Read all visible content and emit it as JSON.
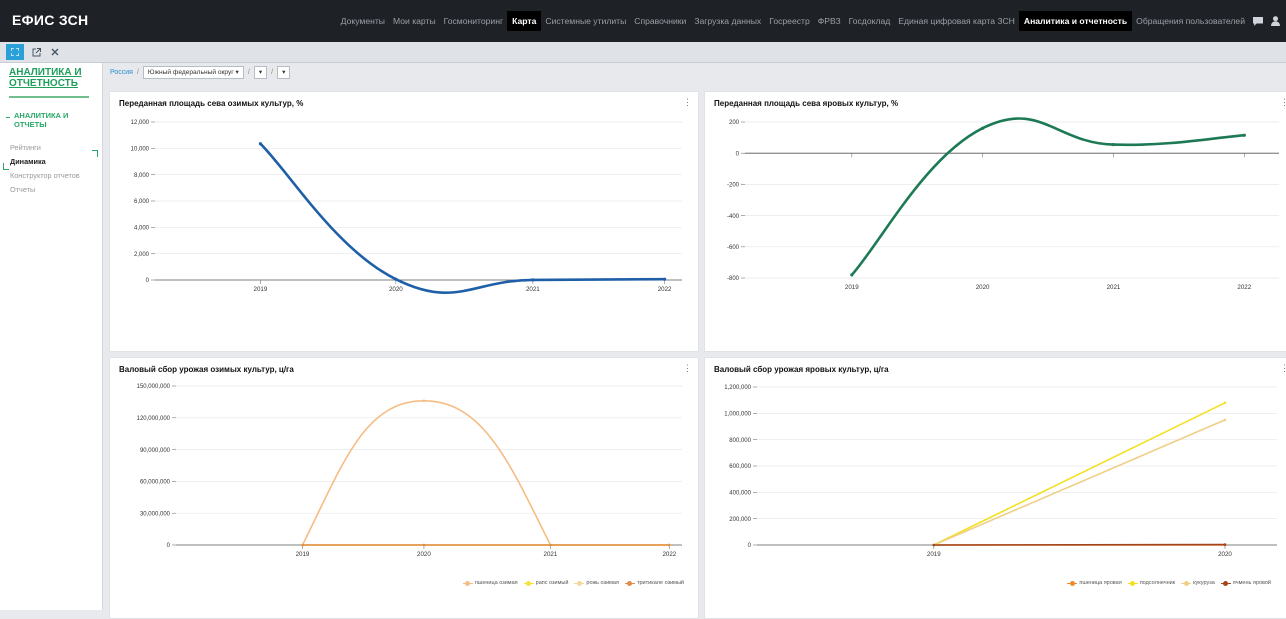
{
  "app": {
    "logo": "ЕФИС ЗСН"
  },
  "nav": {
    "items": [
      {
        "label": "Документы",
        "active": false
      },
      {
        "label": "Мои карты",
        "active": false
      },
      {
        "label": "Госмониторинг",
        "active": false
      },
      {
        "label": "Карта",
        "active": true
      },
      {
        "label": "Системные утилиты",
        "active": false
      },
      {
        "label": "Справочники",
        "active": false
      },
      {
        "label": "Загрузка данных",
        "active": false
      },
      {
        "label": "Госреестр",
        "active": false
      },
      {
        "label": "ФРВЗ",
        "active": false
      },
      {
        "label": "Госдоклад",
        "active": false
      },
      {
        "label": "Единая цифровая карта ЗСН",
        "active": false
      },
      {
        "label": "Аналитика и отчетность",
        "active": true
      },
      {
        "label": "Обращения пользователей",
        "active": false
      }
    ],
    "icons": [
      "message-icon",
      "user-icon"
    ]
  },
  "toolbar": {
    "icons": [
      "expand-icon",
      "external-link-icon",
      "close-icon"
    ]
  },
  "sidebar": {
    "title": "АНАЛИТИКА И ОТЧЕТНОСТЬ",
    "section": "АНАЛИТИКА И ОТЧЕТЫ",
    "items": [
      {
        "label": "Рейтинги",
        "active": false
      },
      {
        "label": "Динамика",
        "active": true
      },
      {
        "label": "Конструктор отчетов",
        "active": false
      },
      {
        "label": "Отчеты",
        "active": false
      }
    ]
  },
  "breadcrumb": {
    "root": "Россия",
    "district": "Южный федеральный округ",
    "select2": "",
    "select3": ""
  },
  "colors": {
    "accent": "#2aa0d8",
    "green": "#1f9e5c"
  },
  "chart_data": [
    {
      "type": "line",
      "title": "Переданная площадь сева озимых культур, %",
      "x": [
        "2019",
        "2020",
        "2021",
        "2022"
      ],
      "series": [
        {
          "values": [
            10350,
            60,
            10,
            60
          ],
          "color": "#1f5fa8"
        }
      ],
      "ylim": [
        0,
        12000
      ],
      "yticks": [
        "0",
        "2,000",
        "4,000",
        "6,000",
        "8,000",
        "10,000",
        "12,000"
      ],
      "grid": true
    },
    {
      "type": "line",
      "title": "Переданная площадь сева яровых культур, %",
      "x": [
        "2019",
        "2020",
        "2021",
        "2022"
      ],
      "series": [
        {
          "values": [
            -780,
            160,
            55,
            115
          ],
          "color": "#1d7a55"
        }
      ],
      "ylim": [
        -800,
        200
      ],
      "yticks": [
        "-800",
        "-600",
        "-400",
        "-200",
        "0",
        "200"
      ],
      "grid": true
    },
    {
      "type": "line",
      "title": "Валовый сбор урожая озимых культур, ц/га",
      "x": [
        "2019",
        "2020",
        "2021",
        "2022"
      ],
      "series": [
        {
          "name": "пшеница озимая",
          "values": [
            0,
            136000000,
            0,
            0
          ],
          "color": "#f5bd84"
        },
        {
          "name": "рапс озимый",
          "values": [
            0,
            0,
            0,
            0
          ],
          "color": "#f2e23a"
        },
        {
          "name": "рожь озимая",
          "values": [
            0,
            0,
            0,
            0
          ],
          "color": "#f5d79a"
        },
        {
          "name": "тритикале озимый",
          "values": [
            0,
            0,
            0,
            0
          ],
          "color": "#e08d4a"
        }
      ],
      "ylim": [
        0,
        150000000
      ],
      "yticks": [
        "0",
        "30,000,000",
        "60,000,000",
        "90,000,000",
        "120,000,000",
        "150,000,000"
      ],
      "grid": true,
      "legend": "bottom-right"
    },
    {
      "type": "line",
      "title": "Валовый сбор урожая яровых культур, ц/га",
      "x": [
        "2019",
        "2020"
      ],
      "series": [
        {
          "name": "пшеница яровая",
          "values": [
            0,
            0
          ],
          "color": "#ef8a2a"
        },
        {
          "name": "подсолнечник",
          "values": [
            0,
            1080000
          ],
          "color": "#f4e021"
        },
        {
          "name": "кукуруза",
          "values": [
            0,
            950000
          ],
          "color": "#efcf86"
        },
        {
          "name": "ячмень яровой",
          "values": [
            0,
            3000
          ],
          "color": "#a0451d"
        }
      ],
      "ylim": [
        0,
        1200000
      ],
      "yticks": [
        "0",
        "200,000",
        "400,000",
        "600,000",
        "800,000",
        "1,000,000",
        "1,200,000"
      ],
      "grid": true,
      "legend": "bottom-right"
    }
  ]
}
